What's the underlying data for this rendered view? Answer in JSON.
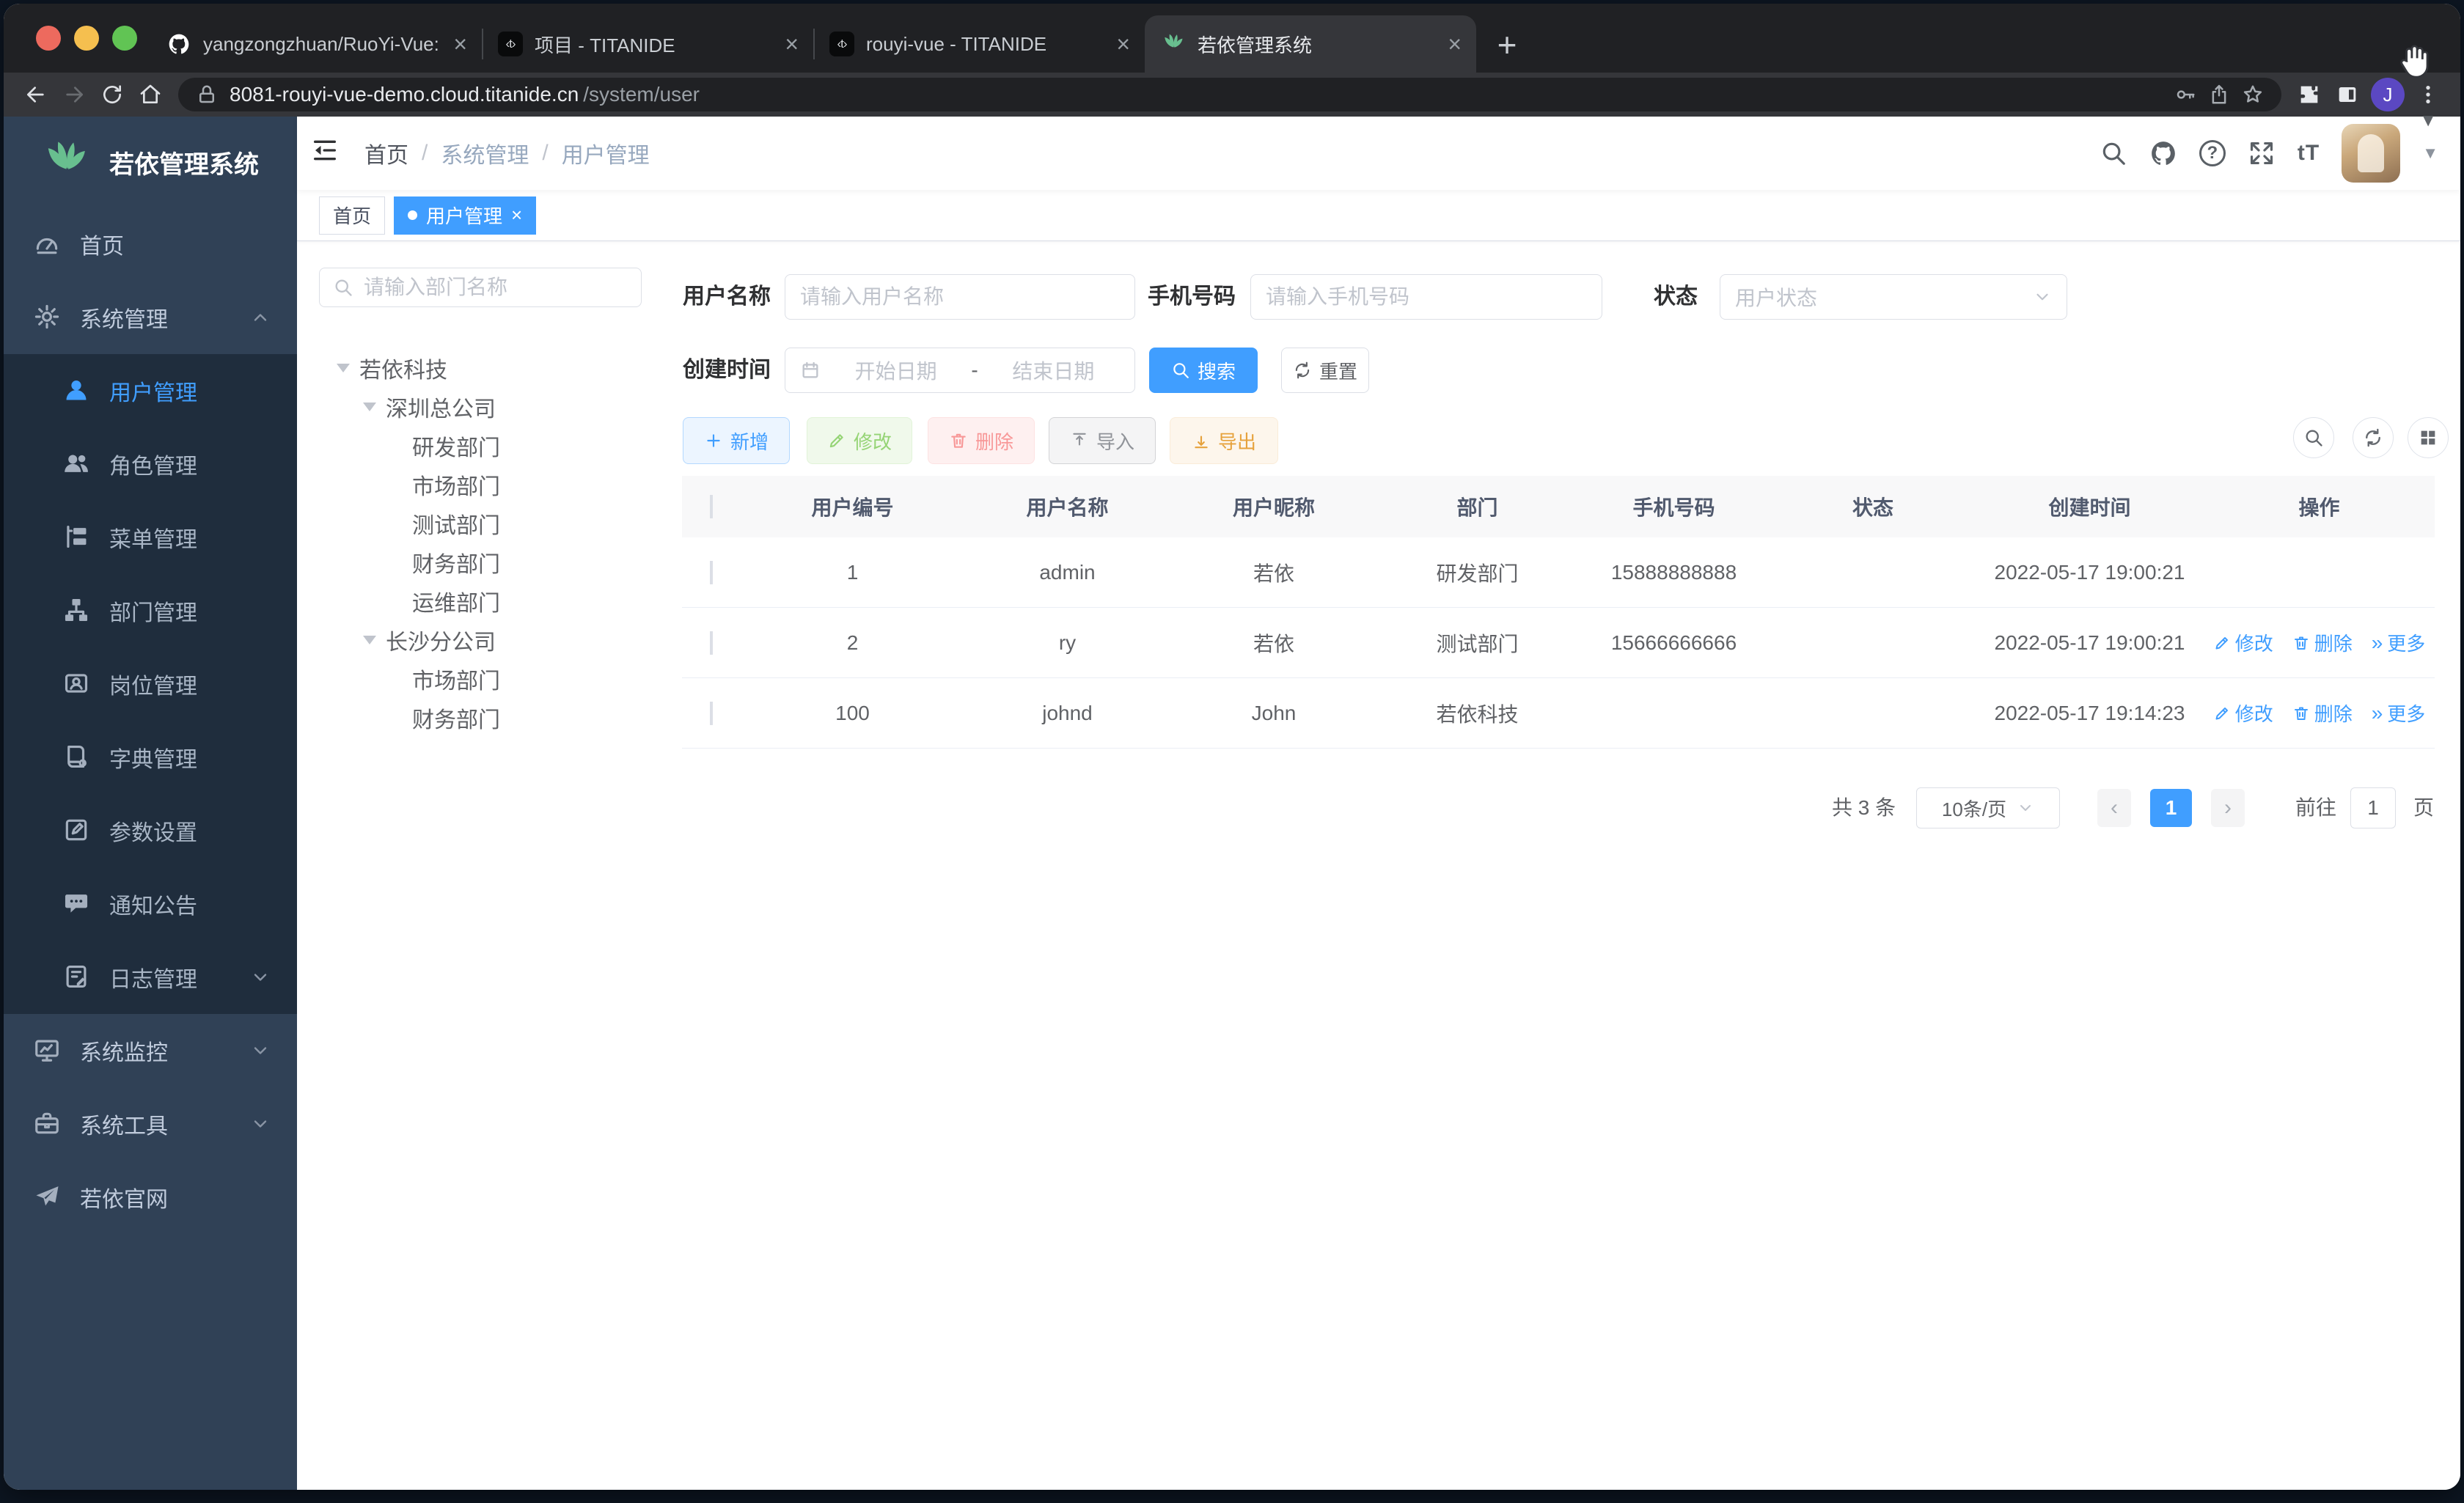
{
  "browser": {
    "tabs": [
      {
        "title": "yangzongzhuan/RuoYi-Vue: (R"
      },
      {
        "title": "项目 - TITANIDE"
      },
      {
        "title": "rouyi-vue - TITANIDE"
      },
      {
        "title": "若依管理系统"
      }
    ],
    "new_tab_glyph": "+",
    "close_glyph": "×",
    "code_fav_glyph": "‹t›",
    "url_host": "8081-rouyi-vue-demo.cloud.titanide.cn",
    "url_path": "/system/user",
    "profile_initial": "J",
    "window_caret_glyph": "▼"
  },
  "sidebar": {
    "logo_title": "若依管理系统",
    "items": [
      {
        "label": "首页"
      },
      {
        "label": "系统管理"
      },
      {
        "label": "用户管理"
      },
      {
        "label": "角色管理"
      },
      {
        "label": "菜单管理"
      },
      {
        "label": "部门管理"
      },
      {
        "label": "岗位管理"
      },
      {
        "label": "字典管理"
      },
      {
        "label": "参数设置"
      },
      {
        "label": "通知公告"
      },
      {
        "label": "日志管理"
      },
      {
        "label": "系统监控"
      },
      {
        "label": "系统工具"
      },
      {
        "label": "若依官网"
      }
    ]
  },
  "navbar": {
    "breadcrumb": [
      "首页",
      "系统管理",
      "用户管理"
    ],
    "separator": "/",
    "question_glyph": "?",
    "font_size_glyph": "tT",
    "avatar_caret_glyph": "▼"
  },
  "tags": {
    "home": "首页",
    "active": "用户管理",
    "close_glyph": "×"
  },
  "tree": {
    "search_placeholder": "请输入部门名称",
    "nodes": [
      {
        "label": "若依科技"
      },
      {
        "label": "深圳总公司"
      },
      {
        "label": "研发部门"
      },
      {
        "label": "市场部门"
      },
      {
        "label": "测试部门"
      },
      {
        "label": "财务部门"
      },
      {
        "label": "运维部门"
      },
      {
        "label": "长沙分公司"
      },
      {
        "label": "市场部门"
      },
      {
        "label": "财务部门"
      }
    ]
  },
  "filters": {
    "username_label": "用户名称",
    "username_placeholder": "请输入用户名称",
    "phone_label": "手机号码",
    "phone_placeholder": "请输入手机号码",
    "status_label": "状态",
    "status_placeholder": "用户状态",
    "date_label": "创建时间",
    "date_start": "开始日期",
    "date_separator": "-",
    "date_end": "结束日期",
    "search_label": "搜索",
    "reset_label": "重置"
  },
  "toolbar": {
    "add": "新增",
    "edit": "修改",
    "delete": "删除",
    "import": "导入",
    "export": "导出"
  },
  "table": {
    "columns": [
      "用户编号",
      "用户名称",
      "用户昵称",
      "部门",
      "手机号码",
      "状态",
      "创建时间",
      "操作"
    ],
    "row_actions": {
      "edit": "修改",
      "delete": "删除",
      "more": "更多",
      "more_glyph": "»"
    },
    "rows": [
      {
        "id": "1",
        "username": "admin",
        "nickname": "若依",
        "dept": "研发部门",
        "phone": "15888888888",
        "status": "on",
        "created": "2022-05-17 19:00:21"
      },
      {
        "id": "2",
        "username": "ry",
        "nickname": "若依",
        "dept": "测试部门",
        "phone": "15666666666",
        "status": "on",
        "created": "2022-05-17 19:00:21"
      },
      {
        "id": "100",
        "username": "johnd",
        "nickname": "John",
        "dept": "若依科技",
        "phone": "",
        "status": "on",
        "created": "2022-05-17 19:14:23"
      }
    ]
  },
  "pagination": {
    "total": "共 3 条",
    "page_size": "10条/页",
    "prev_glyph": "‹",
    "next_glyph": "›",
    "current": "1",
    "goto_label": "前往",
    "goto_value": "1",
    "page_suffix": "页"
  },
  "colors": {
    "primary": "#409eff",
    "sidebar_bg": "#304156",
    "submenu_bg": "#1f2d3d",
    "success": "#67c23a",
    "danger": "#f56c6c",
    "warning": "#e6a23c",
    "info": "#909399",
    "chrome_dark": "#202124",
    "chrome_toolbar": "#35363a"
  }
}
